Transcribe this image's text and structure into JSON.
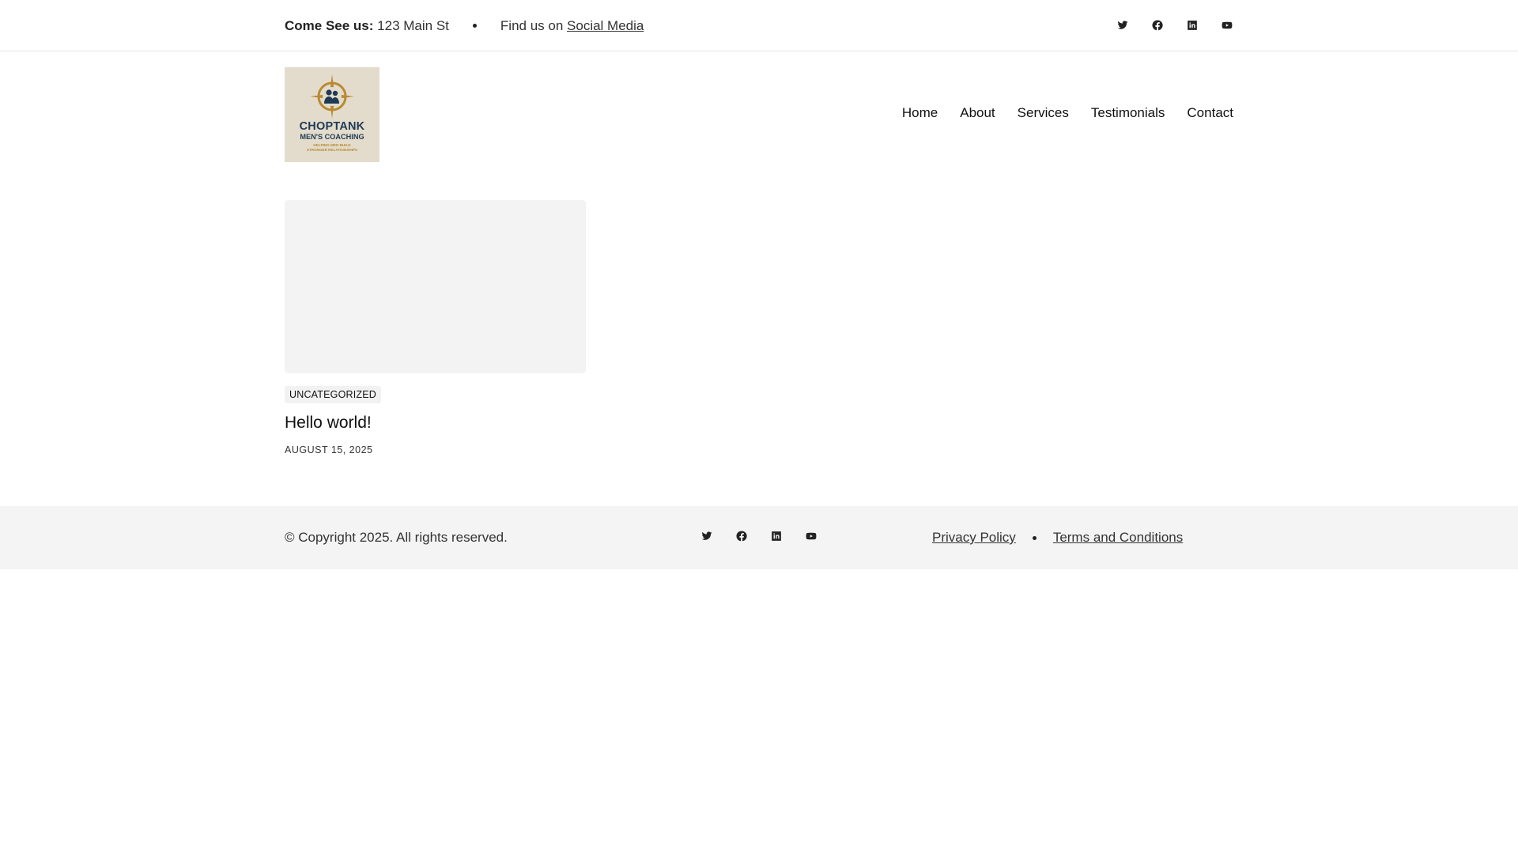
{
  "topbar": {
    "visit_label": "Come See us:",
    "address": "123 Main St",
    "find_prefix": "Find us on",
    "social_link": "Social Media",
    "social_icons": [
      "twitter-icon",
      "facebook-icon",
      "linkedin-icon",
      "youtube-icon"
    ]
  },
  "logo": {
    "line1": "CHOPTANK",
    "line2": "MEN'S COACHING",
    "line3": "HELPING MEN BUILD STRONGER RELATIONSHIPS",
    "colors": {
      "background": "#e3dccd",
      "navy": "#1f3a52",
      "gold": "#b88a32"
    }
  },
  "nav": {
    "items": [
      "Home",
      "About",
      "Services",
      "Testimonials",
      "Contact"
    ]
  },
  "post": {
    "category": "UNCATEGORIZED",
    "title": "Hello world!",
    "date": "AUGUST 15, 2025"
  },
  "footer": {
    "copyright": "© Copyright 2025. All rights reserved.",
    "privacy": "Privacy Policy",
    "terms": "Terms and Conditions",
    "social_icons": [
      "twitter-icon",
      "facebook-icon",
      "linkedin-icon",
      "youtube-icon"
    ]
  }
}
